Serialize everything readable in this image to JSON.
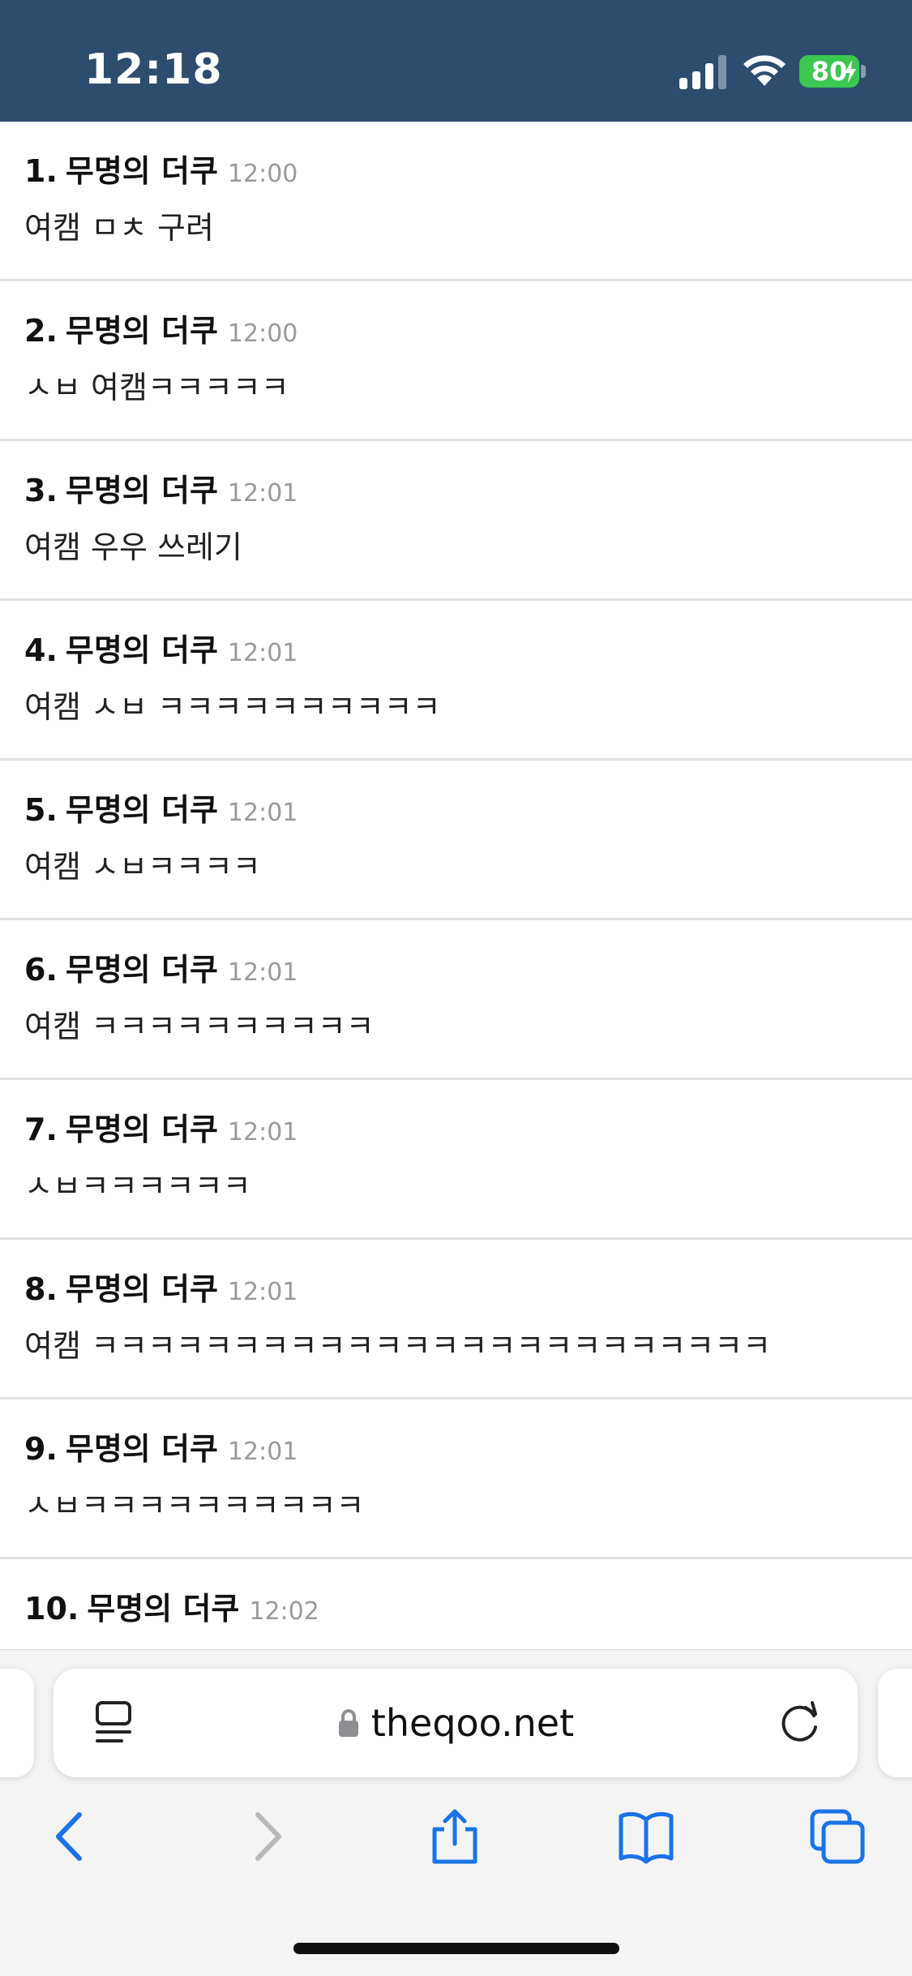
{
  "status_bar": {
    "time": "12:18",
    "battery": "80",
    "background_color": "#2e4d6e",
    "battery_color": "#3cc751"
  },
  "comments": [
    {
      "num": "1.",
      "name": "무명의 더쿠",
      "time": "12:00",
      "text": "여캠 ㅁㅊ 구려"
    },
    {
      "num": "2.",
      "name": "무명의 더쿠",
      "time": "12:00",
      "text": "ㅅㅂ 여캠ㅋㅋㅋㅋㅋ"
    },
    {
      "num": "3.",
      "name": "무명의 더쿠",
      "time": "12:01",
      "text": "여캠 우우 쓰레기"
    },
    {
      "num": "4.",
      "name": "무명의 더쿠",
      "time": "12:01",
      "text": "여캠 ㅅㅂ ㅋㅋㅋㅋㅋㅋㅋㅋㅋㅋ"
    },
    {
      "num": "5.",
      "name": "무명의 더쿠",
      "time": "12:01",
      "text": "여캠 ㅅㅂㅋㅋㅋㅋ"
    },
    {
      "num": "6.",
      "name": "무명의 더쿠",
      "time": "12:01",
      "text": "여캠 ㅋㅋㅋㅋㅋㅋㅋㅋㅋㅋ"
    },
    {
      "num": "7.",
      "name": "무명의 더쿠",
      "time": "12:01",
      "text": "ㅅㅂㅋㅋㅋㅋㅋㅋ"
    },
    {
      "num": "8.",
      "name": "무명의 더쿠",
      "time": "12:01",
      "text": "여캠 ㅋㅋㅋㅋㅋㅋㅋㅋㅋㅋㅋㅋㅋㅋㅋㅋㅋㅋㅋㅋㅋㅋㅋㅋ"
    },
    {
      "num": "9.",
      "name": "무명의 더쿠",
      "time": "12:01",
      "text": "ㅅㅂㅋㅋㅋㅋㅋㅋㅋㅋㅋㅋ"
    },
    {
      "num": "10.",
      "name": "무명의 더쿠",
      "time": "12:02",
      "text": ""
    }
  ],
  "browser": {
    "url": "theqoo.net",
    "icons": [
      "reader-mode-icon",
      "lock-icon",
      "reload-icon",
      "back-icon",
      "forward-icon",
      "share-icon",
      "bookmarks-icon",
      "tabs-icon"
    ],
    "accent_color": "#1a73e8"
  }
}
